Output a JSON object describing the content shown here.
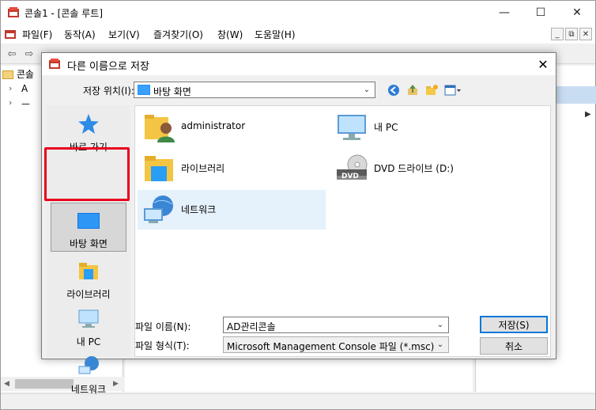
{
  "mmc": {
    "title": "콘솔1 - [콘솔 루트]",
    "menu": [
      "파일(F)",
      "동작(A)",
      "보기(V)",
      "즐겨찾기(O)",
      "창(W)",
      "도움말(H)"
    ],
    "tree_root": "콘솔",
    "tree_items": [
      "A",
      "ㅡ"
    ]
  },
  "dialog": {
    "title": "다른 이름으로 저장",
    "location_label": "저장 위치(I):",
    "location_value": "바탕 화면",
    "places": [
      {
        "label": "바로 가기",
        "icon": "star-icon"
      },
      {
        "label": "바탕 화면",
        "icon": "desktop-icon"
      },
      {
        "label": "라이브러리",
        "icon": "library-folder-icon"
      },
      {
        "label": "내 PC",
        "icon": "computer-icon"
      },
      {
        "label": "네트워크",
        "icon": "network-icon"
      }
    ],
    "files": [
      {
        "label": "administrator",
        "icon": "user-folder-icon"
      },
      {
        "label": "내 PC",
        "icon": "computer-icon"
      },
      {
        "label": "라이브러리",
        "icon": "library-folder-icon"
      },
      {
        "label": "DVD 드라이브 (D:)",
        "icon": "dvd-drive-icon"
      },
      {
        "label": "네트워크",
        "icon": "network-icon"
      }
    ],
    "dvd_badge": "DVD",
    "filename_label": "파일 이름(N):",
    "filename_value": "AD관리콘솔",
    "filetype_label": "파일 형식(T):",
    "filetype_value": "Microsoft Management Console 파일 (*.msc)",
    "save_button": "저장(S)",
    "cancel_button": "취소"
  },
  "colors": {
    "selection": "#e5f1fb",
    "highlight": "#e8001c",
    "accent": "#0078d7"
  }
}
